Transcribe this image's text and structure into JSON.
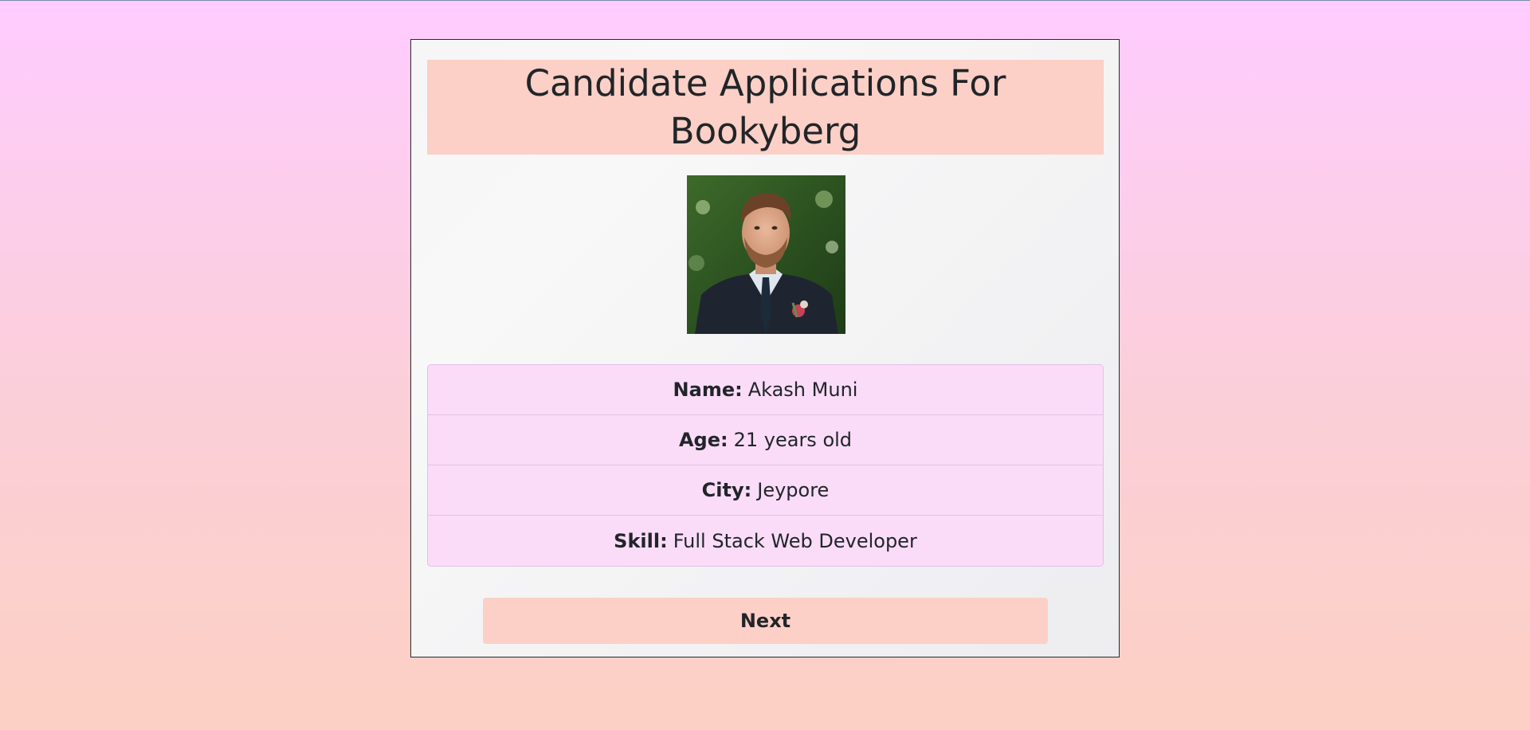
{
  "page": {
    "title": "Candidate Applications For Bookyberg"
  },
  "candidate": {
    "photo_alt": "Candidate photo",
    "fields": [
      {
        "label": "Name:",
        "value": "Akash Muni"
      },
      {
        "label": "Age:",
        "value": "21 years old"
      },
      {
        "label": "City:",
        "value": "Jeypore"
      },
      {
        "label": "Skill:",
        "value": "Full Stack Web Developer"
      }
    ]
  },
  "actions": {
    "next_label": "Next"
  },
  "colors": {
    "background_top": "#ffccff",
    "background_bottom": "#fcd0c3",
    "accent": "#fcd0c6",
    "list_background": "#fadcf9",
    "text": "#212529"
  }
}
